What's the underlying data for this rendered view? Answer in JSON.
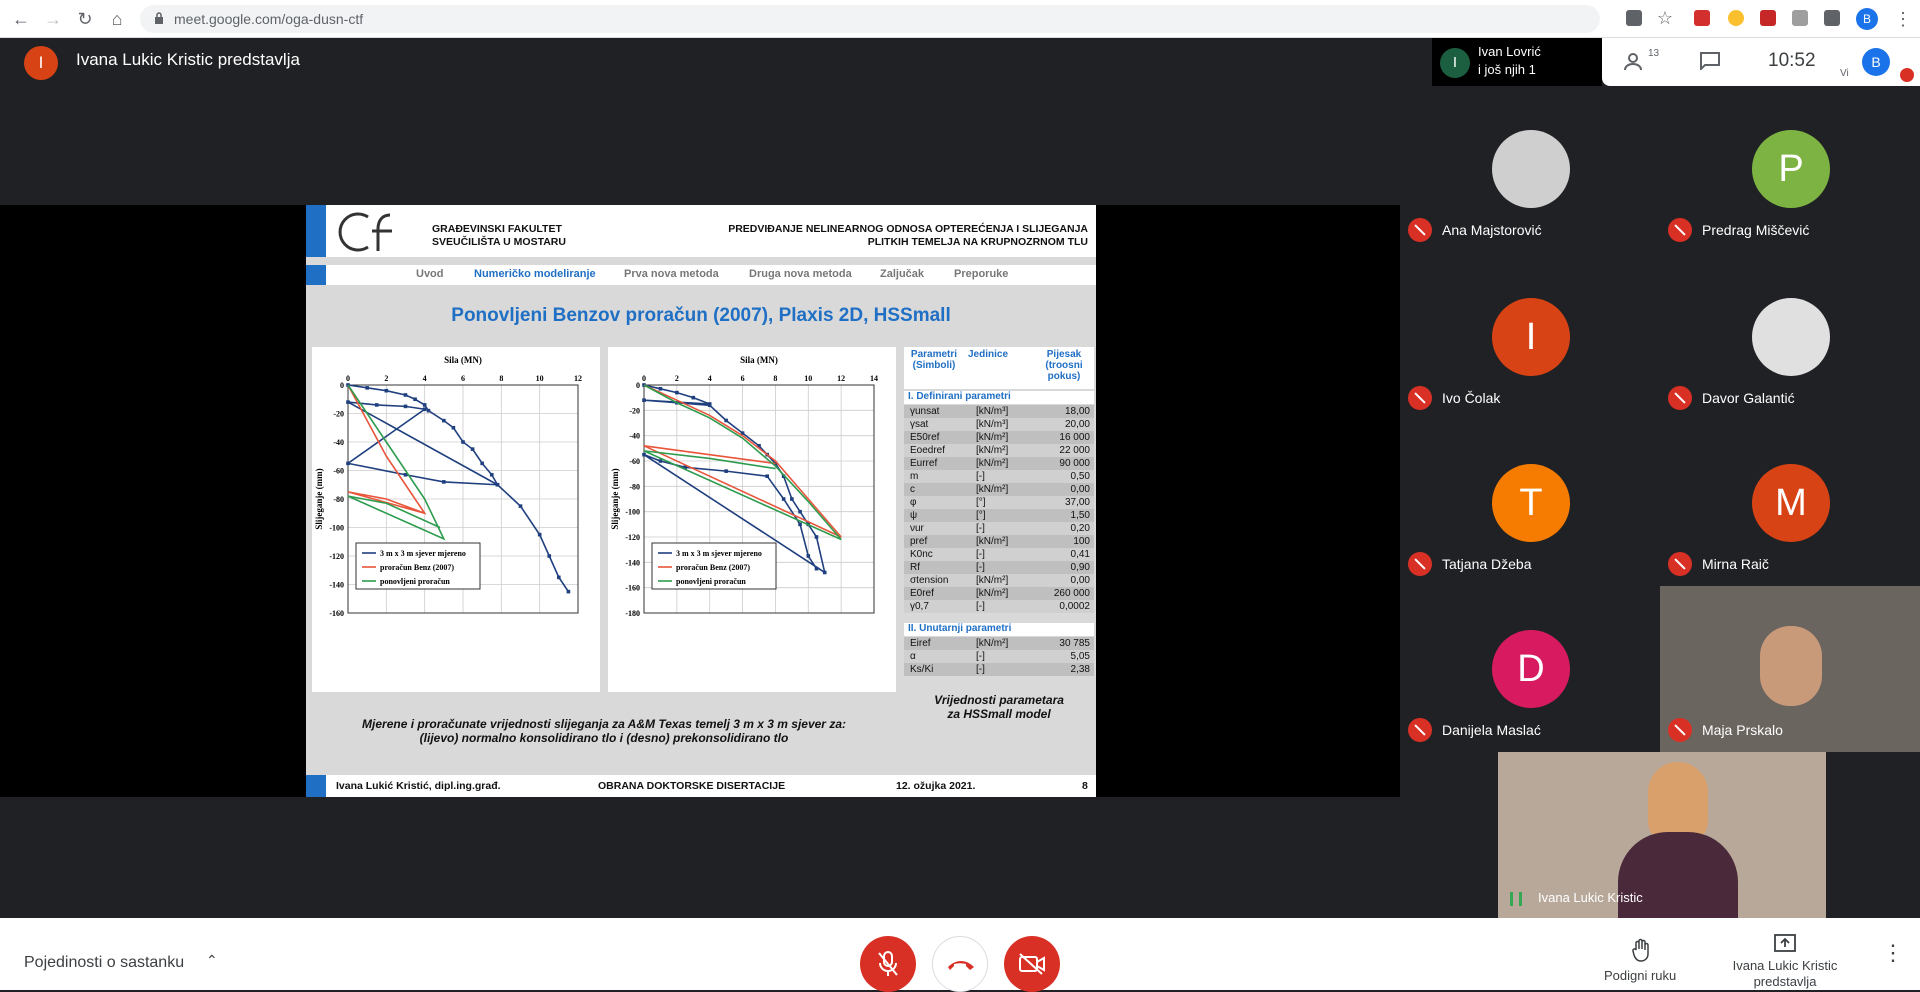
{
  "browser": {
    "url": "meet.google.com/oga-dusn-ctf",
    "profile_initial": "B"
  },
  "meeting": {
    "presenter_banner": "Ivana Lukic Kristic predstavlja",
    "presenter_initial": "I",
    "speaker_card": {
      "initial": "I",
      "line1": "Ivan Lovrić",
      "line2": "i još njih 1"
    },
    "participant_count": "13",
    "time": "10:52",
    "self_initial": "B",
    "self_label": "Vi"
  },
  "slide": {
    "faculty_line1": "GRAĐEVINSKI FAKULTET",
    "faculty_line2": "SVEUČILIŠTA U MOSTARU",
    "thesis_line1": "PREDVIĐANJE NELINEARNOG ODNOSA OPTEREĆENJA I SLIJEGANJA",
    "thesis_line2": "PLITKIH TEMELJA NA KRUPNOZRNOM TLU",
    "menu": [
      "Uvod",
      "Numeričko modeliranje",
      "Prva nova metoda",
      "Druga nova metoda",
      "Zaljučak",
      "Preporuke"
    ],
    "active_menu": "Numeričko modeliranje",
    "title": "Ponovljeni Benzov proračun (2007), Plaxis 2D, HSSmall",
    "caption_line1": "Mjerene i proračunate vrijednosti slijeganja za A&M Texas temelj 3 m x 3 m sjever za:",
    "caption_line2": "(lijevo) normalno konsolidirano tlo i (desno) prekonsolidirano tlo",
    "table_caption_1": "Vrijednosti parametara",
    "table_caption_2": "za HSSmall model",
    "footer_author": "Ivana Lukić Kristić, dipl.ing.građ.",
    "footer_event": "OBRANA DOKTORSKE DISERTACIJE",
    "footer_date": "12. ožujka 2021.",
    "footer_page": "8",
    "table": {
      "h1": "Parametri (Simboli)",
      "h2": "Jedinice",
      "h3": "Pijesak (troosni pokus)",
      "sec1": "I. Definirani parametri",
      "sec2": "II. Unutarnji parametri",
      "rows1": [
        [
          "γunsat",
          "[kN/m³]",
          "18,00"
        ],
        [
          "γsat",
          "[kN/m³]",
          "20,00"
        ],
        [
          "E50ref",
          "[kN/m²]",
          "16 000"
        ],
        [
          "Eoedref",
          "[kN/m²]",
          "22 000"
        ],
        [
          "Eurref",
          "[kN/m²]",
          "90 000"
        ],
        [
          "m",
          "[-]",
          "0,50"
        ],
        [
          "c",
          "[kN/m²]",
          "0,00"
        ],
        [
          "φ",
          "[°]",
          "37,00"
        ],
        [
          "ψ",
          "[°]",
          "1,50"
        ],
        [
          "νur",
          "[-]",
          "0,20"
        ],
        [
          "pref",
          "[kN/m²]",
          "100"
        ],
        [
          "K0nc",
          "[-]",
          "0,41"
        ],
        [
          "Rf",
          "[-]",
          "0,90"
        ],
        [
          "σtension",
          "[kN/m²]",
          "0,00"
        ],
        [
          "E0ref",
          "[kN/m²]",
          "260 000"
        ],
        [
          "γ0,7",
          "[-]",
          "0,0002"
        ]
      ],
      "rows2": [
        [
          "Eiref",
          "[kN/m²]",
          "30 785"
        ],
        [
          "α",
          "[-]",
          "5,05"
        ],
        [
          "Ks/Ki",
          "[-]",
          "2,38"
        ]
      ]
    }
  },
  "chart_data": [
    {
      "type": "line",
      "title": "Sila (MN)",
      "xlabel": "Sila (MN)",
      "ylabel": "Slijeganje (mm)",
      "xlim": [
        0,
        12
      ],
      "ylim": [
        -160,
        0
      ],
      "x_ticks": [
        "0",
        "2",
        "4",
        "6",
        "8",
        "10",
        "12"
      ],
      "y_ticks": [
        "0",
        "-20",
        "-40",
        "-60",
        "-80",
        "-100",
        "-120",
        "-140",
        "-160"
      ],
      "legend": "bottom-left",
      "series": [
        {
          "name": "3 m x 3 m sjever mjereno",
          "color": "#1f3f7f",
          "x": [
            0,
            1,
            2,
            3,
            3.5,
            4,
            4.2,
            5,
            5.5,
            6,
            6.5,
            7,
            7.5,
            7.8,
            0,
            1.5,
            3,
            4,
            0,
            3,
            5,
            7.8,
            9,
            10,
            10.5,
            11,
            11.5
          ],
          "y": [
            0,
            -2,
            -4,
            -7,
            -10,
            -14,
            -18,
            -25,
            -30,
            -40,
            -45,
            -55,
            -63,
            -70,
            -12,
            -14,
            -15,
            -17,
            -55,
            -63,
            -68,
            -70,
            -85,
            -105,
            -120,
            -135,
            -145
          ]
        },
        {
          "name": "proračun Benz (2007)",
          "color": "#e8553a",
          "x": [
            0,
            1,
            2,
            3,
            4,
            0,
            2,
            4
          ],
          "y": [
            0,
            -25,
            -50,
            -70,
            -90,
            -75,
            -80,
            -90
          ]
        },
        {
          "name": "ponovljeni proračun",
          "color": "#2e9c4e",
          "x": [
            0,
            1,
            2,
            3,
            4,
            5,
            0,
            2,
            4.8
          ],
          "y": [
            0,
            -20,
            -40,
            -60,
            -80,
            -108,
            -78,
            -83,
            -100
          ]
        }
      ]
    },
    {
      "type": "line",
      "title": "Sila (MN)",
      "xlabel": "Sila (MN)",
      "ylabel": "Slijeganje (mm)",
      "xlim": [
        0,
        14
      ],
      "ylim": [
        -180,
        0
      ],
      "x_ticks": [
        "0",
        "2",
        "4",
        "6",
        "8",
        "10",
        "12",
        "14"
      ],
      "y_ticks": [
        "0",
        "-20",
        "-40",
        "-60",
        "-80",
        "-100",
        "-120",
        "-140",
        "-160",
        "-180"
      ],
      "legend": "bottom-left",
      "series": [
        {
          "name": "3 m x 3 m sjever mjereno",
          "color": "#1f3f7f",
          "x": [
            0,
            1,
            2,
            3,
            4,
            0,
            2,
            4,
            5,
            6,
            7,
            7.5,
            8,
            8.5,
            9,
            9.5,
            10,
            10.5,
            11,
            0,
            1,
            2.5,
            5,
            7.5,
            8.5,
            9.5,
            10,
            10.5
          ],
          "y": [
            0,
            -3,
            -6,
            -10,
            -15,
            -12,
            -14,
            -16,
            -28,
            -38,
            -48,
            -55,
            -62,
            -72,
            -90,
            -100,
            -110,
            -120,
            -148,
            -55,
            -60,
            -65,
            -68,
            -72,
            -90,
            -110,
            -135,
            -145
          ]
        },
        {
          "name": "proračun Benz (2007)",
          "color": "#e8553a",
          "x": [
            0,
            2,
            4,
            6,
            8,
            10,
            12,
            0,
            4,
            8
          ],
          "y": [
            0,
            -12,
            -24,
            -40,
            -60,
            -90,
            -120,
            -48,
            -55,
            -62
          ]
        },
        {
          "name": "ponovljeni proračun",
          "color": "#2e9c4e",
          "x": [
            0,
            2,
            4,
            6,
            8,
            10,
            12,
            0,
            4,
            8
          ],
          "y": [
            0,
            -14,
            -26,
            -42,
            -64,
            -92,
            -122,
            -52,
            -58,
            -66
          ]
        }
      ]
    }
  ],
  "participants": [
    {
      "name": "Ana Majstorović",
      "initial": "",
      "color": "#cfcfcf"
    },
    {
      "name": "Predrag Miščević",
      "initial": "P",
      "color": "#7cb342"
    },
    {
      "name": "Ivo Čolak",
      "initial": "I",
      "color": "#d84315"
    },
    {
      "name": "Davor Galantić",
      "initial": "",
      "color": "#e0e0e0"
    },
    {
      "name": "Tatjana Džeba",
      "initial": "T",
      "color": "#f57c00"
    },
    {
      "name": "Mirna Raič",
      "initial": "M",
      "color": "#d84315"
    },
    {
      "name": "Danijela Maslać",
      "initial": "D",
      "color": "#d81b60"
    },
    {
      "name": "Maja Prskalo",
      "initial": "",
      "color": "#888"
    }
  ],
  "self_tile_name": "Ivana Lukic Kristic",
  "bottom": {
    "details": "Pojedinosti o sastanku",
    "raise_hand": "Podigni ruku",
    "presenting_1": "Ivana Lukic Kristic",
    "presenting_2": "predstavlja"
  },
  "colors": {
    "accent": "#1a73e8",
    "danger": "#d93025",
    "dark": "#202124"
  }
}
